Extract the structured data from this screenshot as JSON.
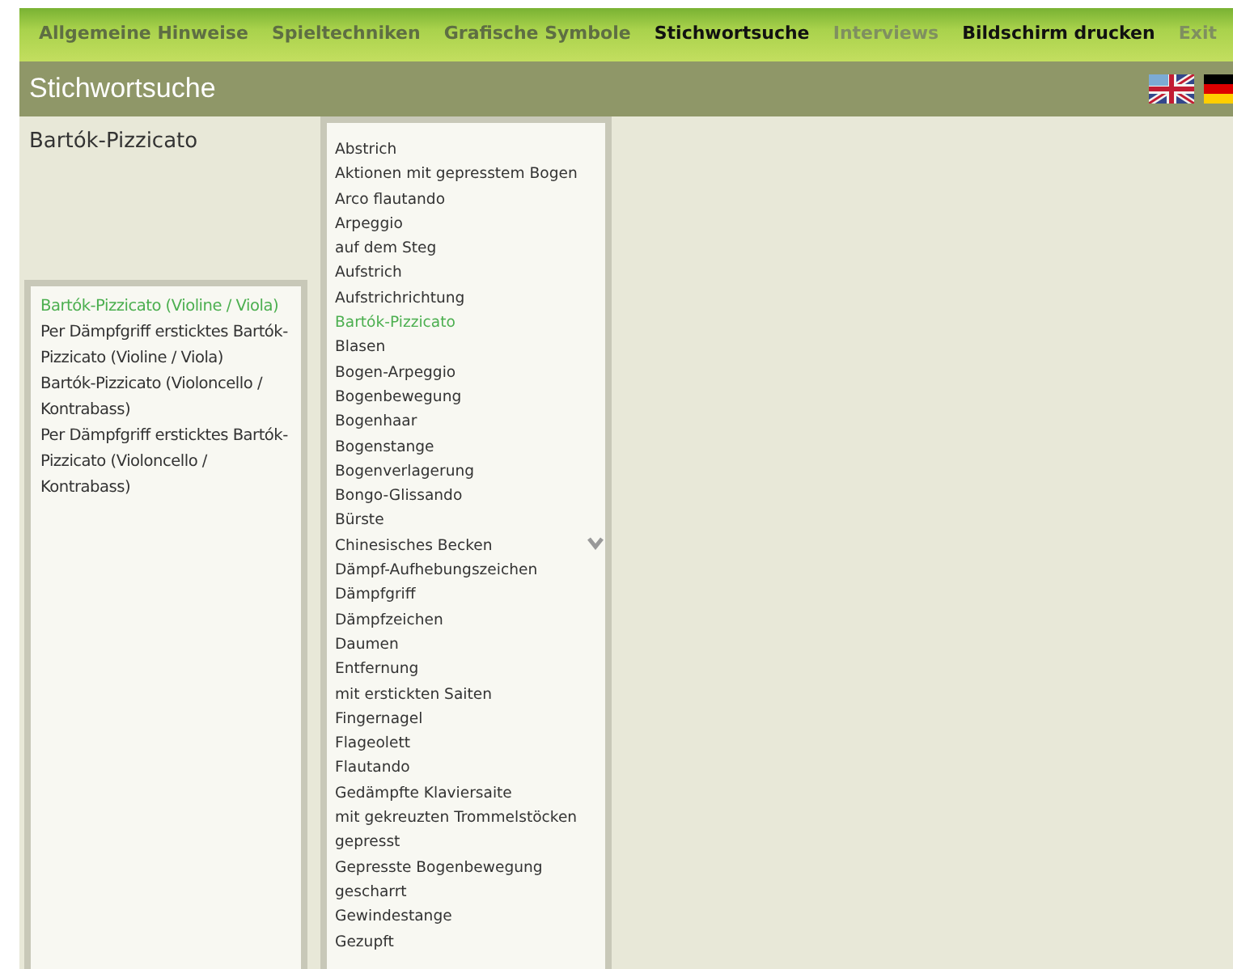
{
  "nav": [
    {
      "label": "Allgemeine Hinweise",
      "kind": "normal"
    },
    {
      "label": "Spieltechniken",
      "kind": "normal"
    },
    {
      "label": "Grafische Symbole",
      "kind": "normal"
    },
    {
      "label": "Stichwortsuche",
      "kind": "active"
    },
    {
      "label": "Interviews",
      "kind": "dim"
    },
    {
      "label": "Bildschirm drucken",
      "kind": "active"
    },
    {
      "label": "Exit",
      "kind": "dim"
    }
  ],
  "page_title": "Stichwortsuche",
  "languages": [
    {
      "kind": "uk",
      "selected": false
    },
    {
      "kind": "de",
      "selected": true
    }
  ],
  "detail": {
    "heading": "Bartók-Pizzicato",
    "entries": [
      {
        "label": "Bartók-Pizzicato (Violine / Viola)",
        "selected": true
      },
      {
        "label": "Per Dämpfgriff ersticktes Bartók-Pizzicato (Violine / Viola)",
        "selected": false
      },
      {
        "label": "Bartók-Pizzicato (Violoncello / Kontrabass)",
        "selected": false
      },
      {
        "label": "Per Dämpfgriff ersticktes Bartók-Pizzicato (Violoncello / Kontrabass)",
        "selected": false
      }
    ]
  },
  "keywords": [
    {
      "label": "Abstrich",
      "selected": false
    },
    {
      "label": "Aktionen mit gepresstem Bogen",
      "selected": false
    },
    {
      "label": "Arco flautando",
      "selected": false
    },
    {
      "label": "Arpeggio",
      "selected": false
    },
    {
      "label": "auf dem Steg",
      "selected": false
    },
    {
      "label": "Aufstrich",
      "selected": false
    },
    {
      "label": "Aufstrichrichtung",
      "selected": false
    },
    {
      "label": "Bartók-Pizzicato",
      "selected": true
    },
    {
      "label": "Blasen",
      "selected": false
    },
    {
      "label": "Bogen-Arpeggio",
      "selected": false
    },
    {
      "label": "Bogenbewegung",
      "selected": false
    },
    {
      "label": "Bogenhaar",
      "selected": false
    },
    {
      "label": "Bogenstange",
      "selected": false
    },
    {
      "label": "Bogenverlagerung",
      "selected": false
    },
    {
      "label": "Bongo-Glissando",
      "selected": false
    },
    {
      "label": "Bürste",
      "selected": false
    },
    {
      "label": "Chinesisches Becken",
      "selected": false
    },
    {
      "label": "Dämpf-Aufhebungszeichen",
      "selected": false
    },
    {
      "label": "Dämpfgriff",
      "selected": false
    },
    {
      "label": "Dämpfzeichen",
      "selected": false
    },
    {
      "label": "Daumen",
      "selected": false
    },
    {
      "label": "Entfernung",
      "selected": false
    },
    {
      "label": "mit erstickten Saiten",
      "selected": false
    },
    {
      "label": "Fingernagel",
      "selected": false
    },
    {
      "label": "Flageolett",
      "selected": false
    },
    {
      "label": "Flautando",
      "selected": false
    },
    {
      "label": "Gedämpfte Klaviersaite",
      "selected": false
    },
    {
      "label": "mit gekreuzten Trommelstöcken",
      "selected": false
    },
    {
      "label": "gepresst",
      "selected": false
    },
    {
      "label": "Gepresste Bogenbewegung",
      "selected": false
    },
    {
      "label": "gescharrt",
      "selected": false
    },
    {
      "label": "Gewindestange",
      "selected": false
    },
    {
      "label": "Gezupft",
      "selected": false
    }
  ]
}
